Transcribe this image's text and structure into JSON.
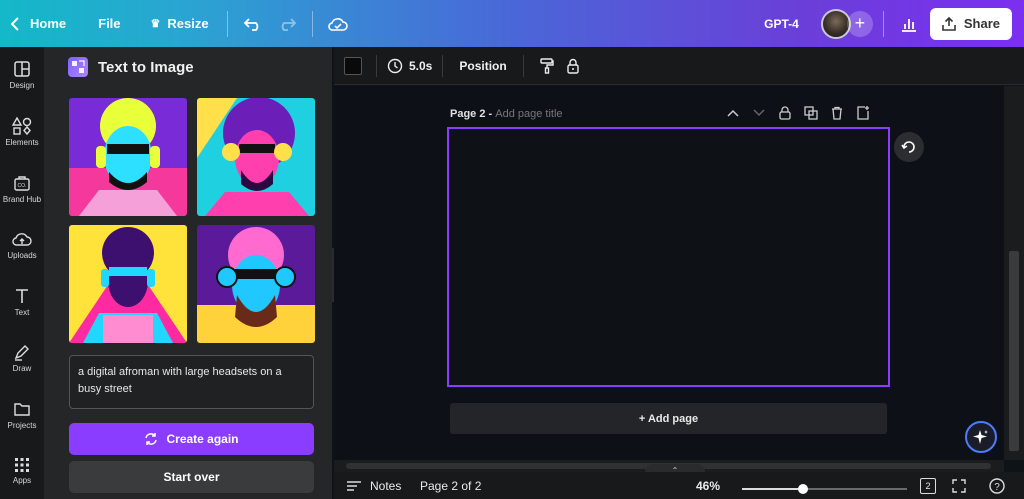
{
  "topbar": {
    "home_label": "Home",
    "file_label": "File",
    "resize_label": "Resize",
    "project_name": "GPT-4",
    "share_label": "Share"
  },
  "rail": {
    "items": [
      {
        "label": "Design",
        "icon": "layout-icon"
      },
      {
        "label": "Elements",
        "icon": "shapes-icon"
      },
      {
        "label": "Brand Hub",
        "icon": "briefcase-icon"
      },
      {
        "label": "Uploads",
        "icon": "cloud-upload-icon"
      },
      {
        "label": "Text",
        "icon": "text-icon"
      },
      {
        "label": "Draw",
        "icon": "pen-icon"
      },
      {
        "label": "Projects",
        "icon": "folder-icon"
      },
      {
        "label": "Apps",
        "icon": "grid-icon"
      }
    ]
  },
  "panel": {
    "title": "Text to Image",
    "prompt": "a digital afroman with large headsets on a busy street",
    "create_again_label": "Create again",
    "start_over_label": "Start over",
    "images": [
      {
        "alt": "Afroman with neon headphones 1",
        "palette": [
          "#f5389c",
          "#2de0ff",
          "#e9ff3a",
          "#7a2bd8"
        ]
      },
      {
        "alt": "Afroman with neon headphones 2",
        "palette": [
          "#1fd0e0",
          "#ff3fae",
          "#ffe04a",
          "#6b1fb8"
        ]
      },
      {
        "alt": "Afroman with neon headphones 3",
        "palette": [
          "#ff2aa1",
          "#ffe23a",
          "#22d7ff",
          "#3d1070"
        ]
      },
      {
        "alt": "Afroman with neon headphones 4",
        "palette": [
          "#ff6ad0",
          "#21c8ff",
          "#ffd23c",
          "#5a1a9a"
        ]
      }
    ]
  },
  "editor": {
    "duration": "5.0s",
    "position_label": "Position"
  },
  "canvas": {
    "page_label": "Page 2 - ",
    "page_title_placeholder": "Add page title",
    "add_page_label": "+ Add page"
  },
  "footer": {
    "notes_label": "Notes",
    "page_indicator": "Page 2 of 2",
    "zoom": "46%",
    "zoom_value": 0.37,
    "page_count_badge": "2"
  }
}
